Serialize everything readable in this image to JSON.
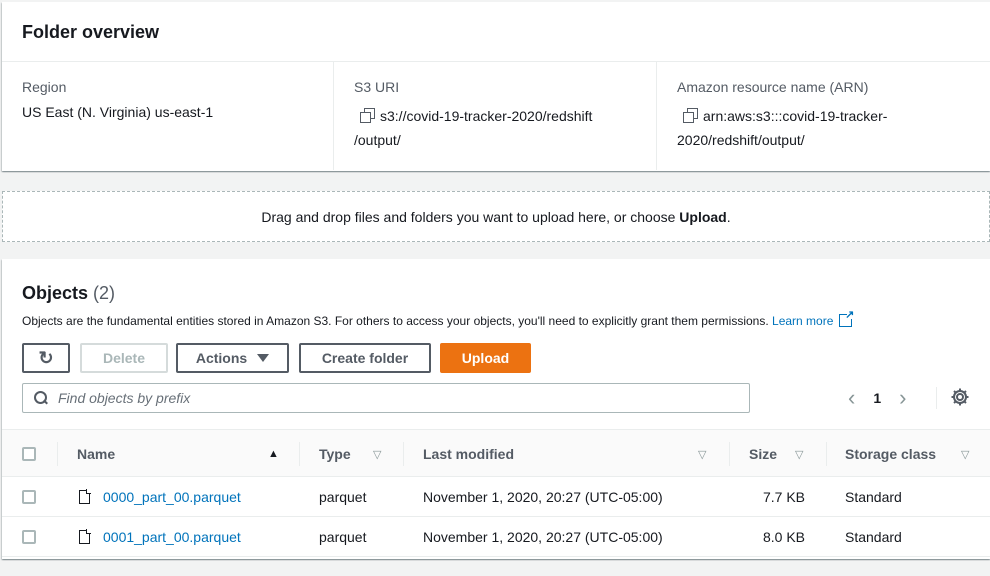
{
  "overview": {
    "title": "Folder overview",
    "region_label": "Region",
    "region_value": "US East (N. Virginia) us-east-1",
    "s3uri_label": "S3 URI",
    "s3uri_line1": "s3://covid-19-tracker-2020/redshift",
    "s3uri_line2": "/output/",
    "arn_label": "Amazon resource name (ARN)",
    "arn_line1": "arn:aws:s3:::covid-19-tracker-",
    "arn_line2": "2020/redshift/output/"
  },
  "dropzone": {
    "text": "Drag and drop files and folders you want to upload here, or choose ",
    "bold": "Upload",
    "suffix": "."
  },
  "objects": {
    "title": "Objects",
    "count": "(2)",
    "description": "Objects are the fundamental entities stored in Amazon S3. For others to access your objects, you'll need to explicitly grant them permissions.",
    "learn_more": "Learn more",
    "buttons": {
      "refresh": "↻",
      "delete": "Delete",
      "actions": "Actions",
      "create_folder": "Create folder",
      "upload": "Upload"
    },
    "search_placeholder": "Find objects by prefix",
    "page": "1",
    "columns": {
      "name": "Name",
      "type": "Type",
      "last_modified": "Last modified",
      "size": "Size",
      "storage_class": "Storage class"
    },
    "rows": [
      {
        "name": "0000_part_00.parquet",
        "type": "parquet",
        "last_modified": "November 1, 2020, 20:27 (UTC-05:00)",
        "size": "7.7 KB",
        "storage_class": "Standard"
      },
      {
        "name": "0001_part_00.parquet",
        "type": "parquet",
        "last_modified": "November 1, 2020, 20:27 (UTC-05:00)",
        "size": "8.0 KB",
        "storage_class": "Standard"
      }
    ]
  },
  "colors": {
    "accent": "#ec7211",
    "link": "#0073bb"
  },
  "icons": [
    "copy-icon",
    "external-link-icon",
    "refresh-icon",
    "caret-down-icon",
    "search-icon",
    "chevron-left-icon",
    "chevron-right-icon",
    "settings-gear-icon",
    "file-icon",
    "sort-asc-icon",
    "sort-icon"
  ]
}
